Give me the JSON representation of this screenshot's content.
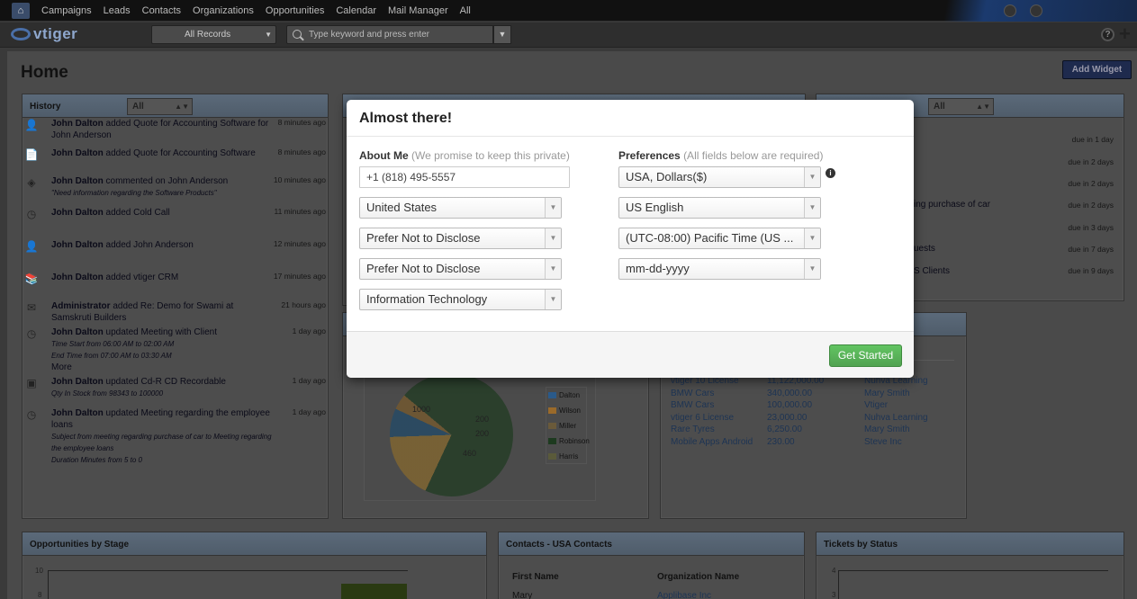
{
  "topnav": {
    "menu": [
      "Campaigns",
      "Leads",
      "Contacts",
      "Organizations",
      "Opportunities",
      "Calendar",
      "Mail Manager",
      "All"
    ]
  },
  "subbar": {
    "brand": "vtiger",
    "records_select": "All Records",
    "search_placeholder": "Type keyword and press enter",
    "help_icon": "?"
  },
  "page": {
    "title": "Home",
    "add_widget": "Add Widget"
  },
  "history": {
    "title": "History",
    "filter": "All",
    "items": [
      {
        "icon": "user-icon",
        "actor": "John Dalton",
        "text": " added Quote for Accounting Software for John Anderson",
        "time": "8 minutes ago"
      },
      {
        "icon": "quote-icon",
        "actor": "John Dalton",
        "text": " added Quote for Accounting Software",
        "time": "8 minutes ago"
      },
      {
        "icon": "comment-icon",
        "actor": "John Dalton",
        "text": " commented on John Anderson",
        "sub": "\"Need information regarding the Software Products\"",
        "time": "10 minutes ago"
      },
      {
        "icon": "clock-icon",
        "actor": "John Dalton",
        "text": " added Cold Call",
        "time": "11 minutes ago"
      },
      {
        "icon": "user-icon",
        "actor": "John Dalton",
        "text": " added John Anderson",
        "time": "12 minutes ago"
      },
      {
        "icon": "book-icon",
        "actor": "John Dalton",
        "text": " added vtiger CRM",
        "time": "17 minutes ago"
      },
      {
        "icon": "mail-icon",
        "actor": "Administrator",
        "text": " added Re: Demo for Swami at Samskruti Builders",
        "time": "21 hours ago"
      },
      {
        "icon": "clock-icon",
        "actor": "John Dalton",
        "text": " updated Meeting with Client",
        "sub": "Time Start from 06:00 AM to 02:00 AM",
        "sub2": "End Time from 07:00 AM to 03:30 AM",
        "more": "More",
        "time": "1 day ago"
      },
      {
        "icon": "box-icon",
        "actor": "John Dalton",
        "text": " updated Cd-R CD Recordable",
        "sub": "Qty In Stock from 98343 to 100000",
        "time": "1 day ago"
      },
      {
        "icon": "clock-icon",
        "actor": "John Dalton",
        "text": " updated Meeting regarding the employee loans",
        "sub": "Subject from meeting regarding purchase of car to Meeting regarding the employee loans",
        "sub2": "Duration Minutes from 5 to 0",
        "time": "1 day ago"
      }
    ]
  },
  "right_widget": {
    "filter": "All",
    "due": [
      "due in 1 day",
      "due in 2 days",
      "due in 2 days",
      "due in 2 days",
      "due in 3 days",
      "due in 7 days",
      "due in 9 days"
    ],
    "fragments": [
      "ing purchase of car",
      "uests",
      "S Clients"
    ]
  },
  "pie_chart": {
    "legend": [
      "Dalton",
      "Wilson",
      "Miller",
      "Robinson",
      "Harris"
    ],
    "labels": [
      "1000",
      "200",
      "200",
      "460"
    ]
  },
  "revenue_table": {
    "rows": [
      {
        "name": "vtiger 10 License",
        "amount": "11,122,000.00",
        "org": "Nuhva Learning"
      },
      {
        "name": "BMW Cars",
        "amount": "340,000.00",
        "org": "Mary Smith"
      },
      {
        "name": "BMW Cars",
        "amount": "100,000.00",
        "org": "Vtiger"
      },
      {
        "name": "vtiger 6 License",
        "amount": "23,000.00",
        "org": "Nuhva Learning"
      },
      {
        "name": "Rare Tyres",
        "amount": "6,250.00",
        "org": "Mary Smith"
      },
      {
        "name": "Mobile Apps Android",
        "amount": "230.00",
        "org": "Steve Inc"
      }
    ]
  },
  "bottom_widgets": {
    "opps_title": "Opportunities by Stage",
    "opps_ticks": [
      "10",
      "8"
    ],
    "contacts_title": "Contacts - USA Contacts",
    "contacts_col1": "First Name",
    "contacts_col2": "Organization Name",
    "contacts_row_name": "Mary",
    "contacts_row_org": "Applibase Inc",
    "tickets_title": "Tickets by Status",
    "tickets_ticks": [
      "4",
      "3"
    ]
  },
  "modal": {
    "title": "Almost there!",
    "about_label": "About Me",
    "about_hint": "(We promise to keep this private)",
    "phone": "+1 (818) 495-5557",
    "country": "United States",
    "gender": "Prefer Not to Disclose",
    "age": "Prefer Not to Disclose",
    "industry": "Information Technology",
    "prefs_label": "Preferences",
    "prefs_hint": "(All fields below are required)",
    "currency": "USA, Dollars($)",
    "language": "US English",
    "timezone": "(UTC-08:00) Pacific Time (US ...",
    "date_format": "mm-dd-yyyy",
    "button": "Get Started"
  }
}
